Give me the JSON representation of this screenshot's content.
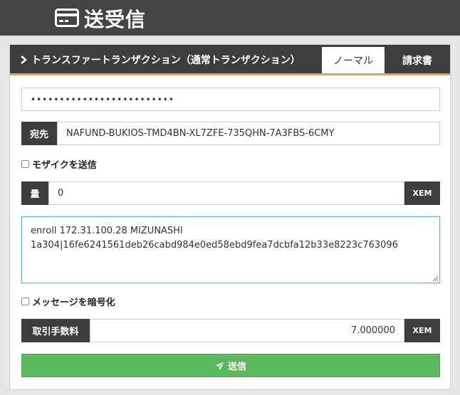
{
  "header": {
    "title": "送受信",
    "icon": "credit-card-icon"
  },
  "panel": {
    "title": "トランスファートランザクション（通常トランザクション）",
    "tabs": [
      {
        "label": "ノーマル",
        "active": true
      },
      {
        "label": "請求書",
        "active": false
      }
    ],
    "accent_color": "#e8a33d"
  },
  "form": {
    "password": "•••••••••••••••••••••••••",
    "recipient_label": "宛先",
    "recipient_value": "NAFUND-BUKIOS-TMD4BN-XL7ZFE-735QHN-7A3FBS-6CMY",
    "mosaic_checkbox_label": "モザイクを送信",
    "amount_label": "量",
    "amount_value": "0",
    "amount_unit": "XEM",
    "message_lines": [
      "enroll 172.31.100.28 MIZUNASHI",
      "1a304|16fe6241561deb26cabd984e0ed58ebd9fea7dcbfa12b33e8223c763096"
    ],
    "encrypt_checkbox_label": "メッセージを暗号化",
    "fee_label": "取引手数料",
    "fee_value": "7.000000",
    "fee_unit": "XEM",
    "send_label": "送信",
    "send_color": "#5cb85c"
  }
}
